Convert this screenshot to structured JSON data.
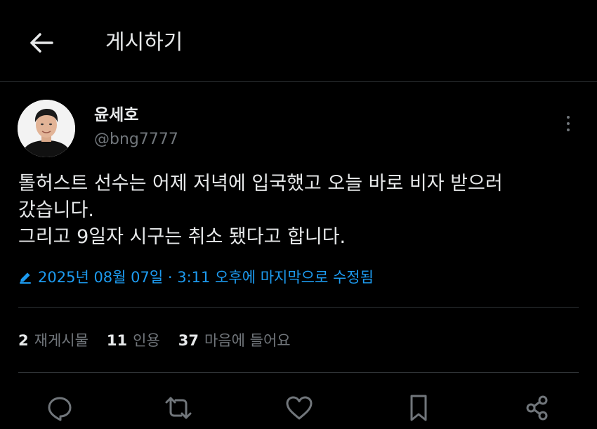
{
  "header": {
    "title": "게시하기"
  },
  "author": {
    "display_name": "윤세호",
    "handle": "@bng7777"
  },
  "tweet": {
    "lines": [
      "톨허스트 선수는 어제 저녁에 입국했고 오늘 바로 비자 받으러",
      "갔습니다.",
      "그리고 9일자 시구는 취소 됐다고 합니다."
    ],
    "edited_text": "2025년 08월 07일 · 3:11 오후에 마지막으로 수정됨"
  },
  "stats": {
    "retweets_count": "2",
    "retweets_label": "재게시물",
    "quotes_count": "11",
    "quotes_label": "인용",
    "likes_count": "37",
    "likes_label": "마음에 들어요"
  },
  "colors": {
    "background": "#000000",
    "text": "#e7e9ea",
    "muted": "#71767b",
    "accent": "#1d9bf0",
    "border": "#2f3336"
  },
  "icons": {
    "back": "arrow-left-icon",
    "more": "more-vertical-icon",
    "edit": "pencil-icon",
    "reply": "reply-icon",
    "retweet": "retweet-icon",
    "like": "heart-icon",
    "bookmark": "bookmark-icon",
    "share": "share-icon"
  }
}
